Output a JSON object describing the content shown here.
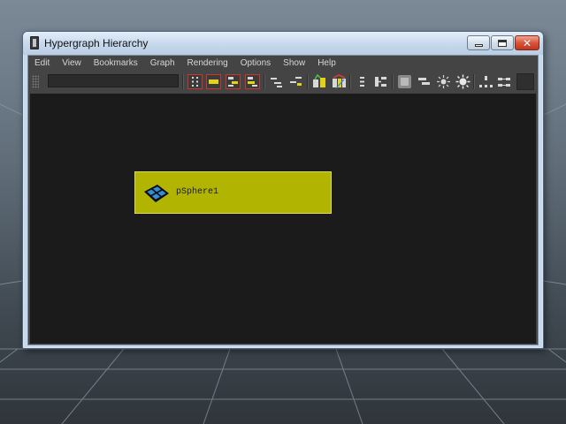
{
  "window": {
    "title": "Hypergraph Hierarchy",
    "controls": {
      "minimize_icon": "minimize-icon",
      "maximize_icon": "maximize-icon",
      "close_glyph": "✕"
    }
  },
  "menubar": {
    "items": [
      "Edit",
      "View",
      "Bookmarks",
      "Graph",
      "Rendering",
      "Options",
      "Show",
      "Help"
    ]
  },
  "toolbar": {
    "name_field_value": "",
    "icons": [
      "select-hierarchy-icon",
      "select-object-icon",
      "select-inputs-icon",
      "select-outputs-icon",
      "collapse-icon",
      "expand-icon",
      "input-connections-icon",
      "input-output-connections-icon",
      "scene-hierarchy-icon",
      "freeform-layout-icon",
      "blank-box-icon",
      "node-display-icon",
      "light-on-icon",
      "light-settings-icon",
      "graph-layout-icon",
      "graph-connections-icon"
    ]
  },
  "graph": {
    "nodes": [
      {
        "label": "pSphere1",
        "icon": "polygon-mesh-icon",
        "color": "#b1b400"
      }
    ]
  },
  "colors": {
    "graph_background": "#1b1b1b",
    "panel": "#444444",
    "node_fill": "#b1b400",
    "title_bar": "#c6d8ec",
    "close_button": "#d8553a"
  }
}
